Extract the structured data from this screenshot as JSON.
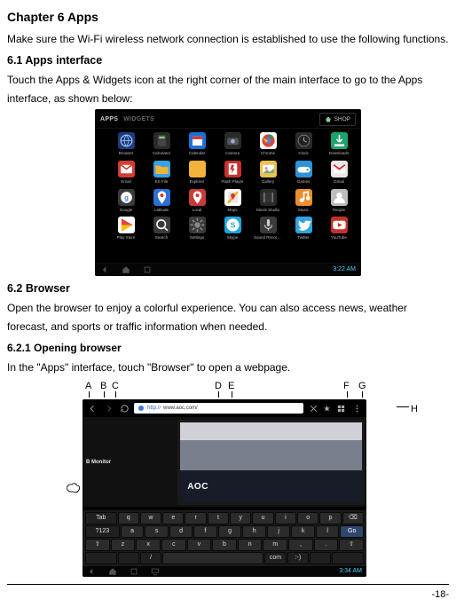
{
  "chapter": {
    "title": "Chapter 6 Apps"
  },
  "intro": "Make sure the Wi-Fi wireless network connection is established to use the following functions.",
  "s61": {
    "title": "6.1 Apps interface",
    "body": "Touch the Apps & Widgets icon at the right corner of the main interface to go to the Apps interface, as shown below:"
  },
  "apps_shot": {
    "tabs": {
      "apps": "APPS",
      "widgets": "WIDGETS"
    },
    "shop": "SHOP",
    "time": "3:22 AM",
    "icons": [
      {
        "label": "Browser",
        "bg": "#1e3a7b",
        "glyph": "globe"
      },
      {
        "label": "Calculator",
        "bg": "#2a2a2a",
        "glyph": "calc"
      },
      {
        "label": "Calendar",
        "bg": "#1d6fd6",
        "glyph": "cal"
      },
      {
        "label": "Camera",
        "bg": "#2a2a2a",
        "glyph": "cam"
      },
      {
        "label": "Chrome",
        "bg": "#ffffff",
        "glyph": "chrome"
      },
      {
        "label": "Clock",
        "bg": "#2a2a2a",
        "glyph": "clock"
      },
      {
        "label": "Downloads",
        "bg": "#1fa36c",
        "glyph": "down"
      },
      {
        "label": "Email",
        "bg": "#d63b32",
        "glyph": "mail"
      },
      {
        "label": "ES File",
        "bg": "#3aa0de",
        "glyph": "folder"
      },
      {
        "label": "Explorer",
        "bg": "#f0b23a",
        "glyph": "folder"
      },
      {
        "label": "Flash Player",
        "bg": "#c63030",
        "glyph": "flash"
      },
      {
        "label": "Gallery",
        "bg": "#eac24d",
        "glyph": "img"
      },
      {
        "label": "Games",
        "bg": "#2f92d6",
        "glyph": "game"
      },
      {
        "label": "Gmail",
        "bg": "#e7e7e7",
        "glyph": "gmail"
      },
      {
        "label": "Google",
        "bg": "#3a3a3a",
        "glyph": "g"
      },
      {
        "label": "Latitude",
        "bg": "#2f6ed6",
        "glyph": "pin"
      },
      {
        "label": "Local",
        "bg": "#c83b3b",
        "glyph": "pin"
      },
      {
        "label": "Maps",
        "bg": "#ffffff",
        "glyph": "maps"
      },
      {
        "label": "Movie Studio",
        "bg": "#2a2a2a",
        "glyph": "film"
      },
      {
        "label": "Music",
        "bg": "#e98f2e",
        "glyph": "music"
      },
      {
        "label": "People",
        "bg": "#bdbdbd",
        "glyph": "people"
      },
      {
        "label": "Play Store",
        "bg": "#ffffff",
        "glyph": "play"
      },
      {
        "label": "Search",
        "bg": "#3a3a3a",
        "glyph": "search"
      },
      {
        "label": "Settings",
        "bg": "#3a3a3a",
        "glyph": "gear"
      },
      {
        "label": "Skype",
        "bg": "#1fa3e0",
        "glyph": "skype"
      },
      {
        "label": "Sound Recorder",
        "bg": "#3a3a3a",
        "glyph": "mic"
      },
      {
        "label": "Twitter",
        "bg": "#2fa3e0",
        "glyph": "tw"
      },
      {
        "label": "YouTube",
        "bg": "#c6302b",
        "glyph": "yt"
      }
    ]
  },
  "s62": {
    "title": "6.2 Browser",
    "body": "Open the browser to enjoy a colorful experience. You can also access news, weather forecast, and sports or traffic information when needed."
  },
  "s621": {
    "title": "6.2.1 Opening browser",
    "body": "In the \"Apps\" interface, touch \"Browser\" to open a webpage."
  },
  "callouts": {
    "a": "A",
    "b": "B",
    "c": "C",
    "d": "D",
    "e": "E",
    "f": "F",
    "g": "G",
    "h": "H"
  },
  "browser_shot": {
    "url_scheme": "http://",
    "url_rest": "www.aoc.com/",
    "brand": "AOC",
    "side_text": "B Monitor",
    "keyboard": {
      "row1": [
        "Tab",
        "q",
        "w",
        "e",
        "r",
        "t",
        "y",
        "u",
        "i",
        "o",
        "p",
        "⌫"
      ],
      "row2": [
        "?123",
        "a",
        "s",
        "d",
        "f",
        "g",
        "h",
        "j",
        "k",
        "l",
        "Go"
      ],
      "row3": [
        "⇧",
        "z",
        "x",
        "c",
        "v",
        "b",
        "n",
        "m",
        ",",
        ".",
        "⇧"
      ],
      "row4": [
        "",
        "",
        "/",
        " ",
        "com",
        ":-)",
        "",
        ""
      ]
    },
    "time": "3:34 AM"
  },
  "page_number": "-18-"
}
